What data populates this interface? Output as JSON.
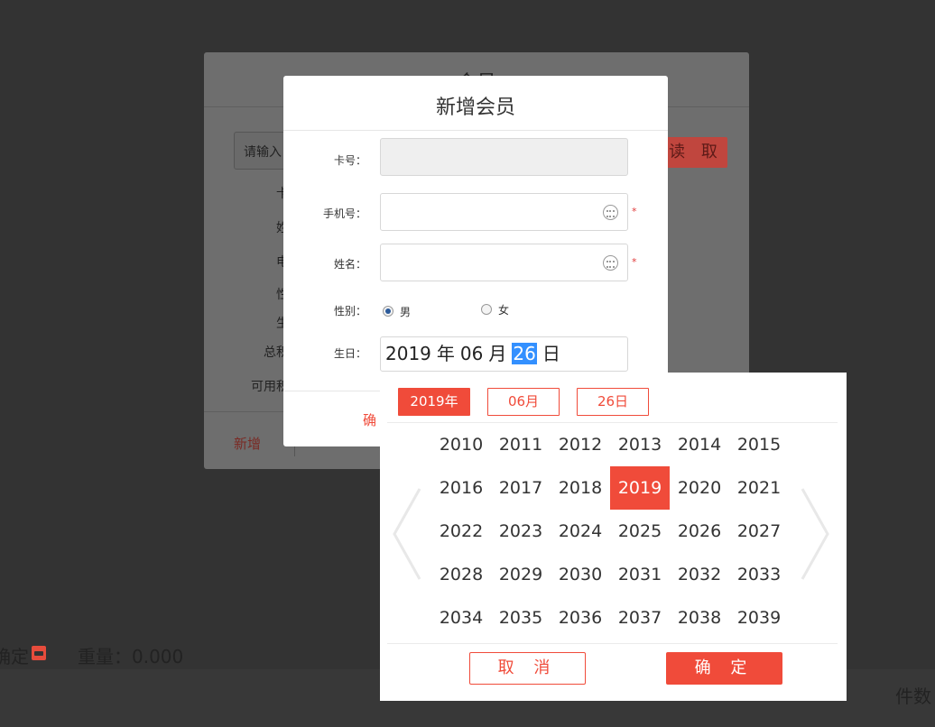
{
  "background": {
    "confirm_fragment": "确定",
    "weight": "重量：0.000",
    "count_fragment": "件数"
  },
  "member_modal": {
    "title_fragment": "会员",
    "search_placeholder": "请输入",
    "read_button": "读 取",
    "labels": [
      "卡",
      "姓",
      "电",
      "性",
      "生",
      "总积",
      "可用积"
    ],
    "add_button": "新增"
  },
  "new_member": {
    "title": "新增会员",
    "card_label": "卡号：",
    "card_value": "",
    "phone_label": "手机号：",
    "phone_value": "",
    "name_label": "姓名：",
    "name_value": "",
    "required_mark": "*",
    "gender_label": "性别：",
    "gender_options": [
      "男",
      "女"
    ],
    "gender_selected": "男",
    "birthday_label": "生日：",
    "birthday": {
      "year": "2019",
      "year_unit": "年",
      "month": "06",
      "month_unit": "月",
      "day": "26",
      "day_unit": "日"
    },
    "confirm_fragment": "确"
  },
  "date_picker": {
    "tabs": [
      "2019年",
      "06月",
      "26日"
    ],
    "active_tab": "2019年",
    "years": [
      "2010",
      "2011",
      "2012",
      "2013",
      "2014",
      "2015",
      "2016",
      "2017",
      "2018",
      "2019",
      "2020",
      "2021",
      "2022",
      "2023",
      "2024",
      "2025",
      "2026",
      "2027",
      "2028",
      "2029",
      "2030",
      "2031",
      "2032",
      "2033",
      "2034",
      "2035",
      "2036",
      "2037",
      "2038",
      "2039"
    ],
    "selected_year": "2019",
    "cancel_label": "取 消",
    "confirm_label": "确 定",
    "accent_color": "#f04b3a"
  }
}
